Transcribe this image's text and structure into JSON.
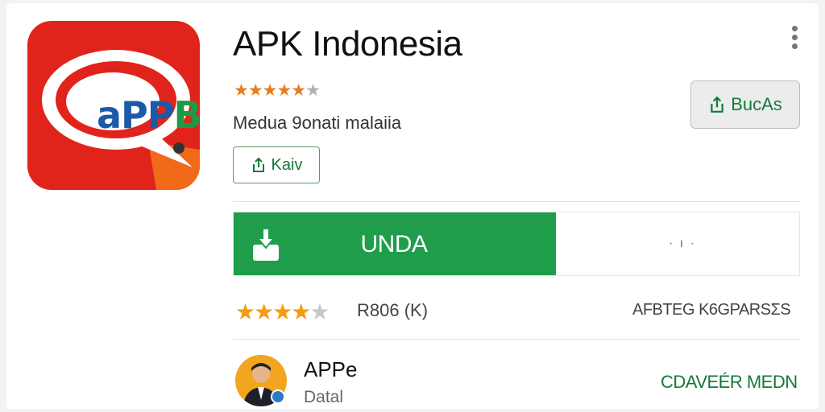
{
  "app": {
    "title": "APK Indonesia",
    "subtitle": "Medua 9onati malaiia",
    "icon_label_blue": "aPP",
    "icon_label_green": "B",
    "header_rating_filled": 5,
    "header_rating_total": 6
  },
  "buttons": {
    "kaiv_label": "Kaiv",
    "bucas_label": "BucAs",
    "download_label": "UNDA",
    "download_progress_percent": 57
  },
  "download": {
    "progress_dots": "· ı ·"
  },
  "rating": {
    "stars_filled": 4,
    "stars_total": 5,
    "count_text": "R806 (K)",
    "related_text": "AFBTEG K6GPARSƩS"
  },
  "developer": {
    "name": "APPe",
    "subtitle": "Datal",
    "contact_label": "CDAVEÉR MEDN"
  },
  "colors": {
    "primary_green": "#1f9d4b",
    "icon_red": "#e0241b",
    "star_orange": "#f29b17"
  },
  "icons": {
    "menu": "more-vert-icon",
    "share": "share-icon",
    "download": "download-icon"
  }
}
